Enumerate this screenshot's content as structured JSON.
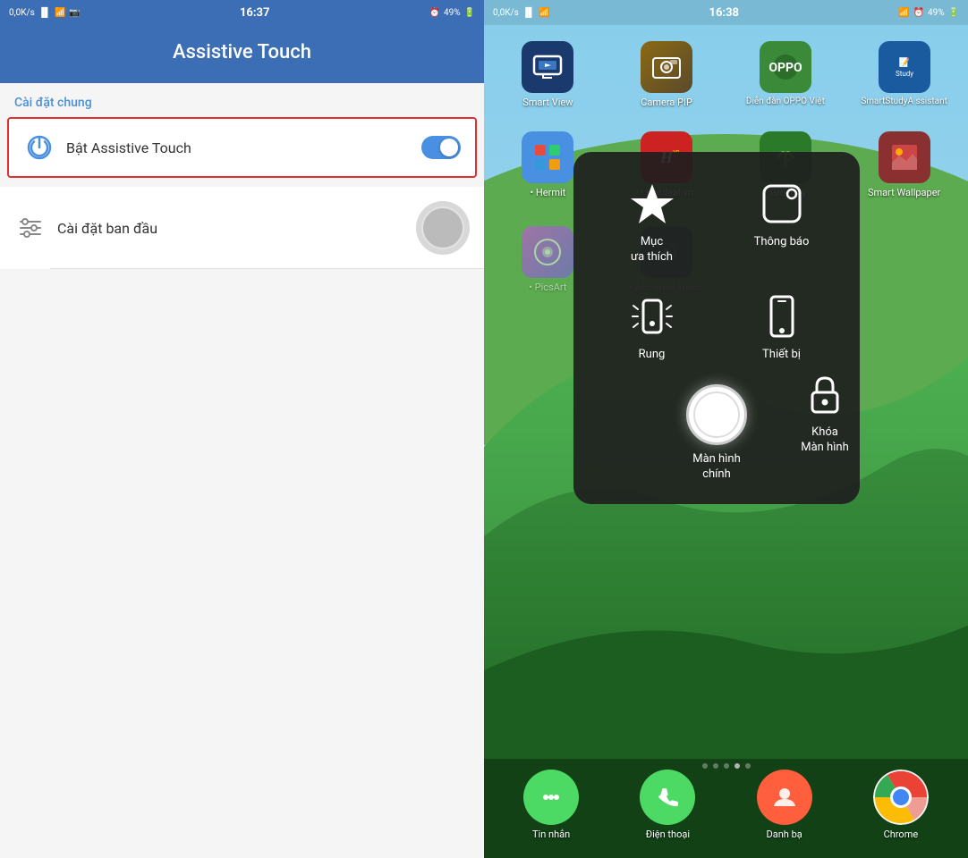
{
  "left": {
    "status_bar": {
      "signal": "0,0K/s",
      "wifi": "WiFi",
      "time": "16:37",
      "alarm": "⏰",
      "battery": "49%"
    },
    "header": {
      "title": "Assistive Touch"
    },
    "section_label": "Cài đặt chung",
    "settings": [
      {
        "id": "bat-assistive-touch",
        "label": "Bật Assistive Touch",
        "toggle": true,
        "toggle_on": true,
        "highlighted": true
      },
      {
        "id": "cai-dat-ban-dau",
        "label": "Cài đặt ban đầu",
        "toggle": false,
        "toggle_on": false,
        "highlighted": false
      }
    ]
  },
  "right": {
    "status_bar": {
      "signal": "0,0K/s",
      "wifi": "WiFi",
      "time": "16:38",
      "alarm": "⏰",
      "battery": "49%"
    },
    "apps_row1": [
      {
        "id": "smart-view",
        "label": "Smart View",
        "bg": "#1a3a6e"
      },
      {
        "id": "camera-pip",
        "label": "Camera PIP",
        "bg": "#8B6914"
      },
      {
        "id": "oppo-forum",
        "label": "Diễn đàn OPPO Việt",
        "bg": "#2a6e2a"
      },
      {
        "id": "smartstudy",
        "label": "SmartStudyAssistant",
        "bg": "#1a5a9e"
      }
    ],
    "apps_row2": [
      {
        "id": "hermit",
        "label": "Hermit",
        "bg": "#4a90e2"
      },
      {
        "id": "hotdeal",
        "label": "Hotdeal.vn",
        "bg": "#cc2222"
      },
      {
        "id": "greenify",
        "label": "Greenify",
        "bg": "#2a7a2a"
      },
      {
        "id": "smart-wallpaper",
        "label": "Smart Wallpaper",
        "bg": "#8B3030"
      }
    ],
    "apps_row3": [
      {
        "id": "picsart",
        "label": "• PicsArt",
        "bg": "linear-gradient(135deg,#e040fb,#7c4dff)"
      },
      {
        "id": "assistive-touch-app",
        "label": "• Assistive Touch",
        "bg": "#1a3a6e"
      },
      {
        "id": "empty1",
        "label": "",
        "bg": "transparent"
      },
      {
        "id": "empty2",
        "label": "",
        "bg": "transparent"
      }
    ],
    "assistive_menu": {
      "items": [
        {
          "id": "thong-bao",
          "label": "Thông báo",
          "position": "top-right"
        },
        {
          "id": "muc-ua-thich",
          "label": "Mục ưa thích",
          "position": "center-left"
        },
        {
          "id": "thiet-bi",
          "label": "Thiết bị",
          "position": "center-right"
        },
        {
          "id": "rung",
          "label": "Rung",
          "position": "bottom-left"
        },
        {
          "id": "man-hinh-chinh",
          "label": "Màn hình chính",
          "position": "bottom-center"
        },
        {
          "id": "khoa-man-hinh",
          "label": "Khóa Màn hình",
          "position": "bottom-right"
        }
      ]
    },
    "dock": [
      {
        "id": "tin-nhan",
        "label": "Tin nhắn",
        "bg": "#4cd964"
      },
      {
        "id": "dien-thoai",
        "label": "Điện thoại",
        "bg": "#4cd964"
      },
      {
        "id": "danh-ba",
        "label": "Danh bạ",
        "bg": "#ff5f3d"
      },
      {
        "id": "chrome",
        "label": "Chrome",
        "bg": "#ea4335"
      }
    ],
    "page_dots": [
      1,
      2,
      3,
      4,
      5
    ]
  }
}
